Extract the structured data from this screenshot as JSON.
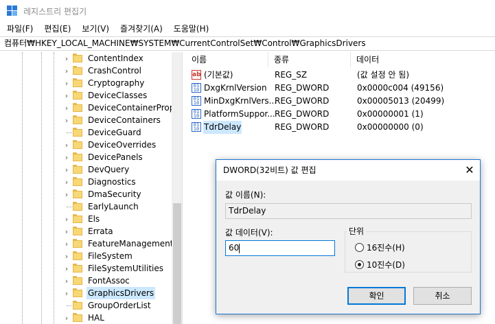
{
  "window": {
    "title": "레지스트리 편집기"
  },
  "menu": [
    "파일(F)",
    "편집(E)",
    "보기(V)",
    "즐겨찾기(A)",
    "도움말(H)"
  ],
  "address": "컴퓨터₩HKEY_LOCAL_MACHINE₩SYSTEM₩CurrentControlSet₩Control₩GraphicsDrivers",
  "tree": {
    "items": [
      {
        "label": "ContentIndex",
        "chevron": true
      },
      {
        "label": "CrashControl",
        "chevron": true
      },
      {
        "label": "Cryptography",
        "chevron": true
      },
      {
        "label": "DeviceClasses",
        "chevron": true
      },
      {
        "label": "DeviceContainerProper",
        "chevron": true
      },
      {
        "label": "DeviceContainers",
        "chevron": true
      },
      {
        "label": "DeviceGuard",
        "chevron": false
      },
      {
        "label": "DeviceOverrides",
        "chevron": true
      },
      {
        "label": "DevicePanels",
        "chevron": true
      },
      {
        "label": "DevQuery",
        "chevron": true
      },
      {
        "label": "Diagnostics",
        "chevron": true
      },
      {
        "label": "DmaSecurity",
        "chevron": true
      },
      {
        "label": "EarlyLaunch",
        "chevron": false
      },
      {
        "label": "Els",
        "chevron": true
      },
      {
        "label": "Errata",
        "chevron": true
      },
      {
        "label": "FeatureManagement",
        "chevron": true
      },
      {
        "label": "FileSystem",
        "chevron": true
      },
      {
        "label": "FileSystemUtilities",
        "chevron": true
      },
      {
        "label": "FontAssoc",
        "chevron": true
      },
      {
        "label": "GraphicsDrivers",
        "chevron": true,
        "selected": true
      },
      {
        "label": "GroupOrderList",
        "chevron": false
      },
      {
        "label": "HAL",
        "chevron": true
      }
    ]
  },
  "list": {
    "headers": [
      "이름",
      "종류",
      "데이터"
    ],
    "rows": [
      {
        "icon": "string-value-icon",
        "name": "(기본값)",
        "type": "REG_SZ",
        "data": "(값 설정 안 됨)"
      },
      {
        "icon": "binary-value-icon",
        "name": "DxgKrnlVersion",
        "type": "REG_DWORD",
        "data": "0x0000c004 (49156)"
      },
      {
        "icon": "binary-value-icon",
        "name": "MinDxgKrnlVers...",
        "type": "REG_DWORD",
        "data": "0x00005013 (20499)"
      },
      {
        "icon": "binary-value-icon",
        "name": "PlatformSuppor...",
        "type": "REG_DWORD",
        "data": "0x00000001 (1)"
      },
      {
        "icon": "binary-value-icon",
        "name": "TdrDelay",
        "type": "REG_DWORD",
        "data": "0x00000000 (0)",
        "selected": true
      }
    ]
  },
  "dialog": {
    "title": "DWORD(32비트) 값 편집",
    "name_label": "값 이름(N):",
    "name_value": "TdrDelay",
    "data_label": "값 데이터(V):",
    "data_value": "60",
    "base_label": "단위",
    "radio_hex": "16진수(H)",
    "radio_dec": "10진수(D)",
    "selected_base": "dec",
    "ok": "확인",
    "cancel": "취소"
  },
  "colors": {
    "accent": "#0078d7",
    "selection": "#cce8ff",
    "folder": "#f8d775"
  }
}
